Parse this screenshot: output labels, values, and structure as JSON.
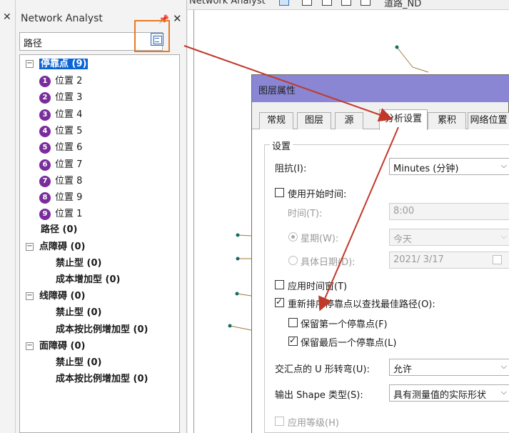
{
  "map_toolbar": {
    "left_text": "Network Analyst",
    "network_name": "道路_ND"
  },
  "network_analyst": {
    "title": "Network Analyst",
    "route_selector": "路径",
    "tree": {
      "stops": {
        "label": "停靠点 (9)",
        "items": [
          {
            "num": "1",
            "label": "位置 2"
          },
          {
            "num": "2",
            "label": "位置 3"
          },
          {
            "num": "3",
            "label": "位置 4"
          },
          {
            "num": "4",
            "label": "位置 5"
          },
          {
            "num": "5",
            "label": "位置 6"
          },
          {
            "num": "6",
            "label": "位置 7"
          },
          {
            "num": "7",
            "label": "位置 8"
          },
          {
            "num": "8",
            "label": "位置 9"
          },
          {
            "num": "9",
            "label": "位置 1"
          }
        ]
      },
      "routes": "路径 (0)",
      "point_barriers": {
        "label": "点障碍 (0)",
        "items": [
          "禁止型 (0)",
          "成本增加型 (0)"
        ]
      },
      "line_barriers": {
        "label": "线障碍 (0)",
        "items": [
          "禁止型 (0)",
          "成本按比例增加型 (0)"
        ]
      },
      "polygon_barriers": {
        "label": "面障碍 (0)",
        "items": [
          "禁止型 (0)",
          "成本按比例增加型 (0)"
        ]
      }
    }
  },
  "dialog": {
    "title": "图层属性",
    "tabs": [
      "常规",
      "图层",
      "源",
      "分析设置",
      "累积",
      "网络位置"
    ],
    "active_tab": "分析设置",
    "group_title": "设置",
    "impedance_label": "阻抗(I):",
    "impedance_value": "Minutes (分钟)",
    "use_start_time_label": "使用开始时间:",
    "time_label": "时间(T):",
    "time_value": "8:00",
    "weekday_label": "星期(W):",
    "weekday_value": "今天",
    "date_label": "具体日期(D):",
    "date_value": "2021/  3/17",
    "time_windows_label": "应用时间窗(T)",
    "reorder_label": "重新排序停靠点以查找最佳路径(O):",
    "keep_first_label": "保留第一个停靠点(F)",
    "keep_last_label": "保留最后一个停靠点(L)",
    "uturn_label": "交汇点的 U 形转弯(U):",
    "uturn_value": "允许",
    "shape_label": "输出 Shape 类型(S):",
    "shape_value": "具有测量值的实际形状",
    "hierarchy_label": "应用等级(H)"
  },
  "colors": {
    "highlight_box": "#e77a26",
    "arrow": "#c0392b",
    "stop_badge": "#7a2c9c",
    "dialog_title": "#8a86d4",
    "selection": "#0a64d6"
  }
}
